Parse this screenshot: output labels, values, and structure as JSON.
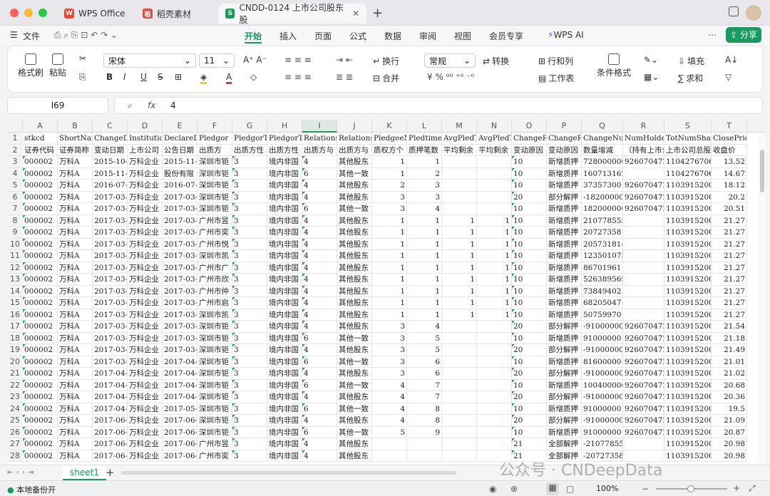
{
  "titlebar": {
    "tabs": [
      "WPS Office",
      "稻壳素材",
      "CNDD-0124 上市公司股东股"
    ]
  },
  "menu": {
    "file": "文件",
    "items": [
      "开始",
      "插入",
      "页面",
      "公式",
      "数据",
      "审阅",
      "视图",
      "会员专享"
    ],
    "ai": "WPS AI",
    "share": "分享"
  },
  "ribbon": {
    "format_painter": "格式刷",
    "paste": "粘贴",
    "font": "宋体",
    "size": "11",
    "wrap": "换行",
    "merge": "合并",
    "numfmt": "常规",
    "convert": "转换",
    "rowcol": "行和列",
    "sheet": "工作表",
    "condfmt": "条件格式",
    "fill": "填充",
    "sum": "求和"
  },
  "formula": {
    "cellref": "I69",
    "value": "4",
    "fx": "fx"
  },
  "columns": [
    "A",
    "B",
    "C",
    "D",
    "E",
    "F",
    "G",
    "H",
    "I",
    "J",
    "K",
    "L",
    "M",
    "N",
    "O",
    "P",
    "Q",
    "R",
    "S",
    "T"
  ],
  "rows": [
    [
      "stkcd",
      "ShortNan",
      "ChangeDa",
      "Institutio",
      "DeclareDa",
      "Pledgor",
      "PledgorTy",
      "PledgorTy",
      "Relations",
      "Relations",
      "PledgeeNi",
      "Pledtimes",
      "AvgPledT",
      "AvgPledT",
      "ChangeRe",
      "ChangeRe",
      "ChangeNun",
      "NumHolder",
      "TotNumShare",
      "ClosePrice"
    ],
    [
      "证券代码",
      "证券简称",
      "变动日期",
      "上市公司",
      "公告日期",
      "出质方",
      "出质方性",
      "出质方性",
      "出质方与",
      "出质方与",
      "质权方个",
      "质押笔数",
      "平均剩余",
      "平均剩余",
      "变动原因",
      "变动原因",
      "数量增减",
      "（持有上市公",
      "上市公司总股",
      "收盘价"
    ],
    [
      "000002",
      "万科A",
      "2015-10-15",
      "万科企业",
      "2015-11-11",
      "深圳市钜",
      "3",
      "境内非国",
      "4",
      "其他股东",
      "1",
      "1",
      "",
      "",
      "10",
      "新增质押",
      "728000000",
      "926070472",
      "11042767064",
      "13.52"
    ],
    [
      "000002",
      "万科A",
      "2015-11-18",
      "万科企业",
      "股份有限",
      "深圳市钜",
      "3",
      "境内非国",
      "6",
      "其他一致",
      "1",
      "2",
      "",
      "",
      "10",
      "新增质押",
      "160713162",
      "",
      "11042767064",
      "14.67"
    ],
    [
      "000002",
      "万科A",
      "2016-07-12",
      "万科企业",
      "2016-07-14",
      "深圳市钜",
      "3",
      "境内非国",
      "4",
      "其他股东",
      "2",
      "3",
      "",
      "",
      "10",
      "新增质押",
      "37357300",
      "926070472",
      "11039152001",
      "18.12"
    ],
    [
      "000002",
      "万科A",
      "2017-03-03",
      "万科企业",
      "2017-03-08",
      "深圳市钜",
      "3",
      "境内非国",
      "4",
      "其他股东",
      "3",
      "3",
      "",
      "",
      "20",
      "部分解押",
      "-182000000",
      "926070472",
      "11039152001",
      "20.2"
    ],
    [
      "000002",
      "万科A",
      "2017-03-09",
      "万科企业",
      "2017-03-14",
      "深圳市钜",
      "3",
      "境内非国",
      "6",
      "其他一致",
      "3",
      "4",
      "",
      "",
      "10",
      "新增质押",
      "182000000",
      "926070472",
      "11039152001",
      "20.51"
    ],
    [
      "000002",
      "万科A",
      "2017-03-10",
      "万科企业",
      "2017-03-13",
      "广州市昱",
      "3",
      "境内非国",
      "4",
      "其他股东",
      "1",
      "1",
      "1",
      "1",
      "10",
      "新增质押",
      "210778555",
      "",
      "11039152001",
      "21.27"
    ],
    [
      "000002",
      "万科A",
      "2017-03-10",
      "万科企业",
      "2017-03-13",
      "广州市奕",
      "3",
      "境内非国",
      "4",
      "其他股东",
      "1",
      "1",
      "1",
      "1",
      "10",
      "新增质押",
      "207273581",
      "",
      "11039152001",
      "21.27"
    ],
    [
      "000002",
      "万科A",
      "2017-03-10",
      "万科企业",
      "2017-03-13",
      "广州市悦",
      "3",
      "境内非国",
      "4",
      "其他股东",
      "1",
      "1",
      "1",
      "1",
      "10",
      "新增质押",
      "205731814",
      "",
      "11039152001",
      "21.27"
    ],
    [
      "000002",
      "万科A",
      "2017-03-10",
      "万科企业",
      "2017-03-13",
      "深圳市凯",
      "3",
      "境内非国",
      "4",
      "其他股东",
      "1",
      "1",
      "1",
      "1",
      "10",
      "新增质押",
      "123501075",
      "",
      "11039152001",
      "21.27"
    ],
    [
      "000002",
      "万科A",
      "2017-03-10",
      "万科企业",
      "2017-03-13",
      "广州市广",
      "3",
      "境内非国",
      "4",
      "其他股东",
      "1",
      "1",
      "1",
      "1",
      "10",
      "新增质押",
      "86701961",
      "",
      "11039152001",
      "21.27"
    ],
    [
      "000002",
      "万科A",
      "2017-03-10",
      "万科企业",
      "2017-03-13",
      "广州市欣",
      "3",
      "境内非国",
      "4",
      "其他股东",
      "1",
      "1",
      "1",
      "1",
      "10",
      "新增质押",
      "526389569",
      "",
      "11039152001",
      "21.27"
    ],
    [
      "000002",
      "万科A",
      "2017-03-10",
      "万科企业",
      "2017-03-13",
      "广州市仲",
      "3",
      "境内非国",
      "4",
      "其他股东",
      "1",
      "1",
      "1",
      "1",
      "10",
      "新增质押",
      "73849402",
      "",
      "11039152001",
      "21.27"
    ],
    [
      "000002",
      "万科A",
      "2017-03-10",
      "万科企业",
      "2017-03-13",
      "广州市启",
      "3",
      "境内非国",
      "4",
      "其他股东",
      "1",
      "1",
      "1",
      "1",
      "10",
      "新增质押",
      "68205047",
      "",
      "11039152001",
      "21.27"
    ],
    [
      "000002",
      "万科A",
      "2017-03-10",
      "万科企业",
      "2017-03-13",
      "深圳市凯",
      "3",
      "境内非国",
      "4",
      "其他股东",
      "1",
      "1",
      "1",
      "1",
      "10",
      "新增质押",
      "50759970",
      "",
      "11039152001",
      "21.27"
    ],
    [
      "000002",
      "万科A",
      "2017-03-17",
      "万科企业",
      "2017-03-21",
      "深圳市钜",
      "3",
      "境内非国",
      "4",
      "其他股东",
      "3",
      "4",
      "",
      "",
      "20",
      "部分解押",
      "-91000000",
      "926070472",
      "11039152001",
      "21.54"
    ],
    [
      "000002",
      "万科A",
      "2017-03-21",
      "万科企业",
      "2017-03-23",
      "深圳市钜",
      "3",
      "境内非国",
      "6",
      "其他一致",
      "3",
      "5",
      "",
      "",
      "10",
      "新增质押",
      "91000000",
      "926070472",
      "11039152001",
      "21.18"
    ],
    [
      "000002",
      "万科A",
      "2017-03-24",
      "万科企业",
      "2017-03-28",
      "深圳市钜",
      "3",
      "境内非国",
      "4",
      "其他股东",
      "3",
      "5",
      "",
      "",
      "20",
      "部分解押",
      "-91000000",
      "926070472",
      "11039152001",
      "21.49"
    ],
    [
      "000002",
      "万科A",
      "2017-03-29",
      "万科企业",
      "2017-04-01",
      "深圳市钜",
      "3",
      "境内非国",
      "6",
      "其他一致",
      "3",
      "6",
      "",
      "",
      "10",
      "新增质押",
      "81600000",
      "926070472",
      "11039152001",
      "21.01"
    ],
    [
      "000002",
      "万科A",
      "2017-04-12",
      "万科企业",
      "2017-04-20",
      "深圳市钜",
      "3",
      "境内非国",
      "4",
      "其他股东",
      "3",
      "6",
      "",
      "",
      "20",
      "部分解押",
      "-91000000",
      "926070472",
      "11039152001",
      "21.02"
    ],
    [
      "000002",
      "万科A",
      "2017-04-21",
      "万科企业",
      "2017-04-26",
      "深圳市钜",
      "3",
      "境内非国",
      "6",
      "其他一致",
      "4",
      "7",
      "",
      "",
      "10",
      "新增质押",
      "100400000",
      "926070472",
      "11039152001",
      "20.68"
    ],
    [
      "000002",
      "万科A",
      "2017-04-26",
      "万科企业",
      "2017-04-28",
      "深圳市钜",
      "3",
      "境内非国",
      "4",
      "其他股东",
      "4",
      "7",
      "",
      "",
      "20",
      "部分解押",
      "-91000000",
      "926070472",
      "11039152001",
      "20.36"
    ],
    [
      "000002",
      "万科A",
      "2017-04-28",
      "万科企业",
      "2017-05-04",
      "深圳市钜",
      "3",
      "境内非国",
      "6",
      "其他一致",
      "4",
      "8",
      "",
      "",
      "10",
      "新增质押",
      "91000000",
      "926070472",
      "11039152001",
      "19.5"
    ],
    [
      "000002",
      "万科A",
      "2017-06-01",
      "万科企业",
      "2017-06-06",
      "深圳市钜",
      "3",
      "境内非国",
      "4",
      "其他股东",
      "4",
      "8",
      "",
      "",
      "20",
      "部分解押",
      "-91000000",
      "926070472",
      "11039152001",
      "21.09"
    ],
    [
      "000002",
      "万科A",
      "2017-06-06",
      "万科企业",
      "2017-06-09",
      "深圳市钜",
      "3",
      "境内非国",
      "6",
      "其他一致",
      "5",
      "9",
      "",
      "",
      "10",
      "新增质押",
      "91000000",
      "926070472",
      "11039152001",
      "20.87"
    ],
    [
      "000002",
      "万科A",
      "2017-06-19",
      "万科企业",
      "2017-06-21",
      "广州市昱",
      "3",
      "境内非国",
      "4",
      "其他股东",
      "",
      "",
      "",
      "",
      "21",
      "全部解押",
      "-210778555",
      "",
      "11039152001",
      "20.98"
    ],
    [
      "000002",
      "万科A",
      "2017-06-19",
      "万科企业",
      "2017-06-21",
      "广州市奕",
      "3",
      "境内非国",
      "4",
      "其他股东",
      "",
      "",
      "",
      "",
      "21",
      "全部解押",
      "-207273581",
      "",
      "11039152001",
      "20.98"
    ]
  ],
  "sheets": {
    "name": "sheet1"
  },
  "status": {
    "backup": "本地备份开",
    "zoom": "100%"
  },
  "watermark": "公众号 · CNDeepData"
}
